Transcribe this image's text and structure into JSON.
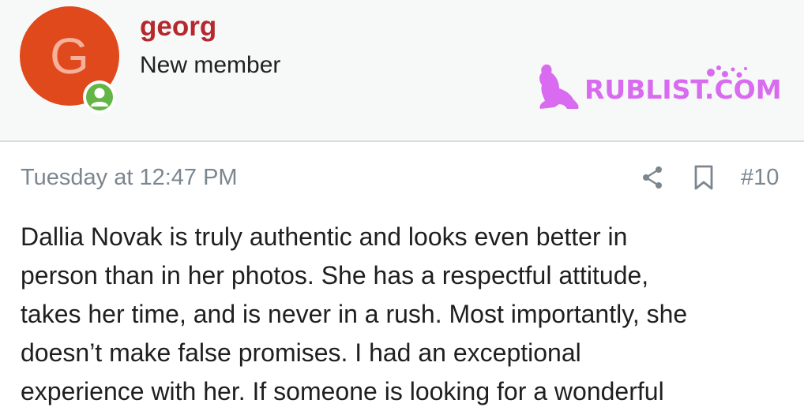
{
  "user": {
    "avatar_letter": "G",
    "avatar_color": "#e0491c",
    "online_color": "#63b545",
    "username": "georg",
    "title": "New member",
    "online_icon": "user-icon"
  },
  "watermark": {
    "text": "RUBLIST.COM",
    "color": "#d86bf0"
  },
  "post": {
    "date": "Tuesday at 12:47 PM",
    "number": "#10",
    "share_icon": "share-icon",
    "bookmark_icon": "bookmark-icon",
    "lines": [
      "Dallia Novak is truly authentic and looks even better in",
      "person than in her photos. She has a respectful attitude,",
      "takes her time, and is never in a rush. Most importantly, she",
      "doesn’t make false promises. I had an exceptional",
      "experience with her. If someone is looking for a wonderful"
    ]
  }
}
